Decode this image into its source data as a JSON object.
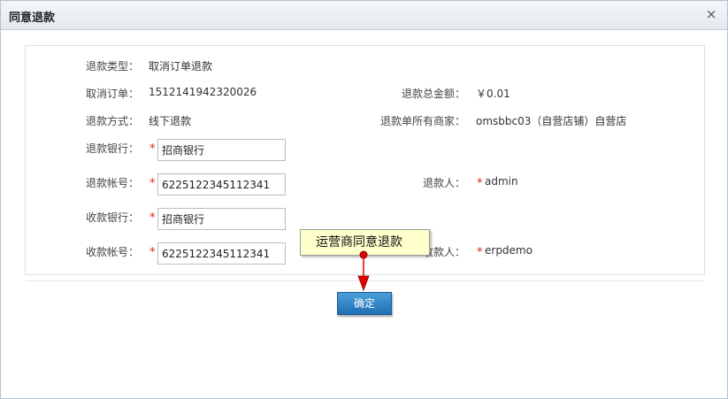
{
  "dialog": {
    "title": "同意退款",
    "close_symbol": "×"
  },
  "form": {
    "refund_type_label": "退款类型：",
    "refund_type_value": "取消订单退款",
    "cancel_order_label": "取消订单：",
    "cancel_order_value": "1512141942320026",
    "total_amount_label": "退款总金额：",
    "total_amount_value": "￥0.01",
    "refund_method_label": "退款方式：",
    "refund_method_value": "线下退款",
    "merchant_label": "退款单所有商家：",
    "merchant_value": "omsbbc03（自营店铺）自营店",
    "refund_bank_label": "退款银行：",
    "refund_bank_value": "招商银行",
    "refund_account_label": "退款帐号：",
    "refund_account_value": "6225122345112341",
    "refund_person_label": "退款人：",
    "refund_person_value": "admin",
    "receive_bank_label": "收款银行：",
    "receive_bank_value": "招商银行",
    "receive_account_label": "收款帐号：",
    "receive_account_value": "6225122345112341",
    "receiver_label": "收款人：",
    "receiver_value": "erpdemo",
    "required_mark": "*"
  },
  "callout": {
    "text": "运营商同意退款"
  },
  "actions": {
    "confirm_label": "确定"
  },
  "colors": {
    "accent": "#1f6fb5",
    "required": "#e2231a",
    "callout_bg": "#ffffcc",
    "arrow": "#e00000"
  },
  "icons": {
    "close": "close-icon",
    "arrow": "arrow-down-icon"
  }
}
